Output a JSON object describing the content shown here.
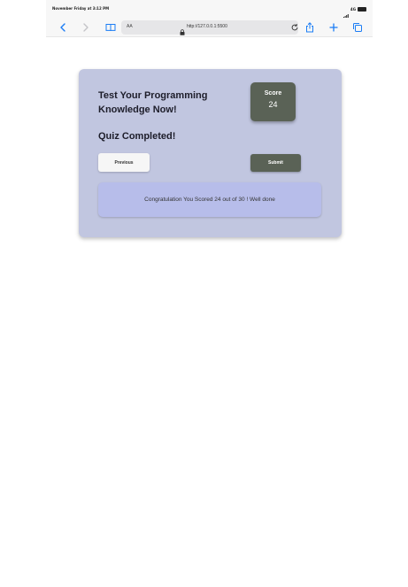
{
  "status_bar": {
    "time": "November Friday at 3:12 PM",
    "network": "4G"
  },
  "browser": {
    "text_size_label": "AA",
    "url": "http://127.0.0.1:5500",
    "icons": [
      "back-icon",
      "forward-icon",
      "book-icon",
      "lock-icon",
      "reload-icon",
      "share-icon",
      "plus-icon",
      "tabs-icon"
    ]
  },
  "quiz": {
    "title": "Test Your Programming Knowledge Now!",
    "score_label": "Score",
    "score_value": "24",
    "status": "Quiz Completed!",
    "previous_label": "Previous",
    "submit_label": "Submit",
    "result_message": "Congratulation You Scored 24 out of 30 ! Well done"
  },
  "colors": {
    "card_bg": "#c1c6e0",
    "accent_dark": "#5a6256",
    "result_bg": "#b7bdea",
    "browser_blue": "#1a7cf5"
  }
}
